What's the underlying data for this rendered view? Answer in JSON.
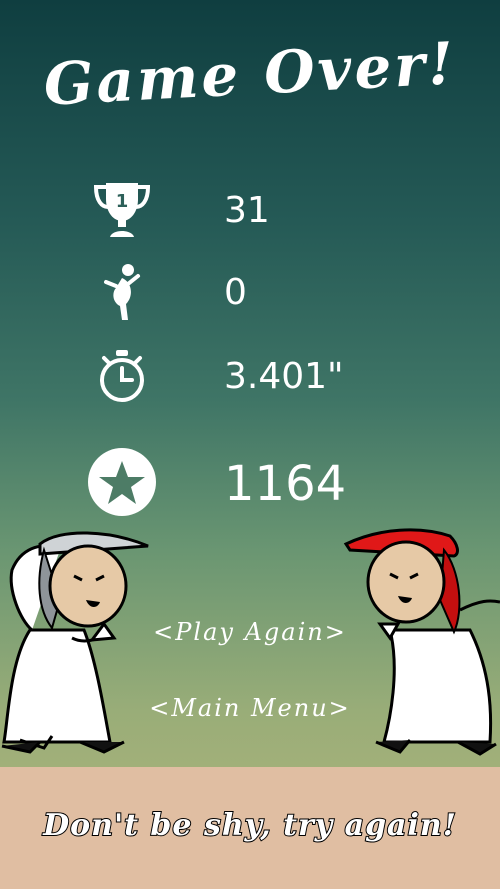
{
  "screen": {
    "title": "Game Over!",
    "stats": {
      "best_value": "31",
      "best_icon": "trophy-icon",
      "catches_value": "0",
      "catches_icon": "player-icon",
      "time_value": "3.401\"",
      "time_icon": "stopwatch-icon",
      "score_value": "1164",
      "score_icon": "star-icon"
    },
    "buttons": {
      "play_again": "<Play Again>",
      "main_menu": "<Main Menu>"
    },
    "tagline": "Don't be shy, try again!",
    "colors": {
      "ground": "#e0bea2",
      "headscarf_left": "#cfd3d6",
      "headscarf_right": "#e01818",
      "text": "#ffffff"
    }
  }
}
